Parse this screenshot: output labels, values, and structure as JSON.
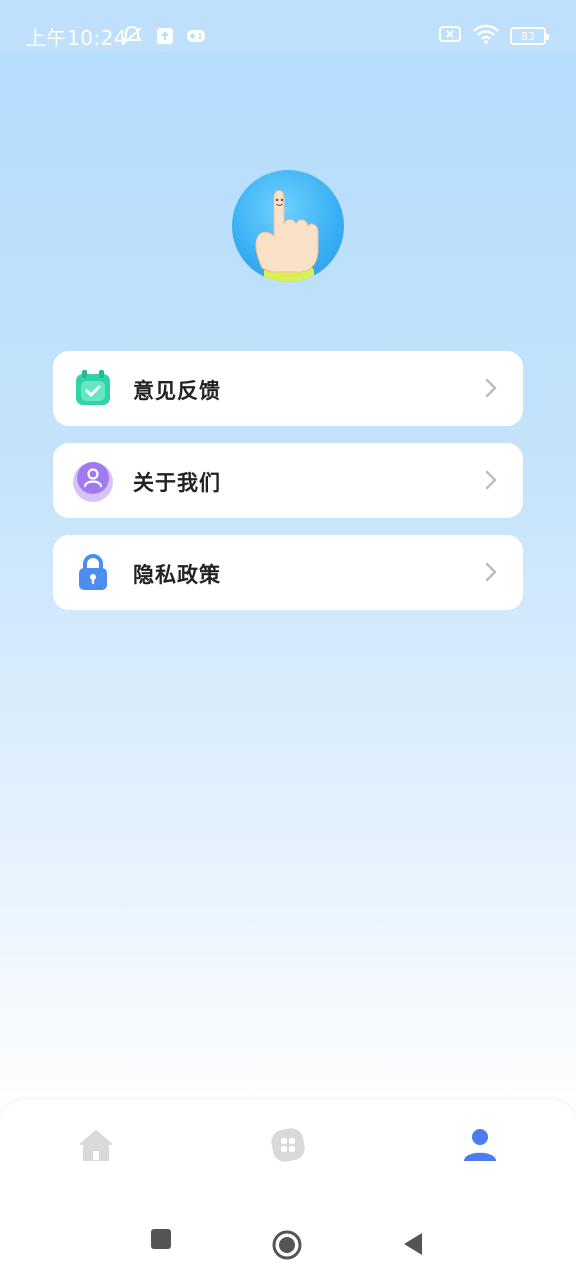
{
  "status_bar": {
    "time": "上午10:24",
    "battery_level": "83",
    "icons": [
      "alarm-off-icon",
      "upload-icon",
      "gamepad-icon",
      "sim-error-icon",
      "wifi-icon",
      "battery-icon"
    ]
  },
  "profile": {
    "avatar_icon": "pointing-hand-avatar"
  },
  "menu": {
    "items": [
      {
        "label": "意见反馈",
        "icon": "feedback-calendar-check-icon",
        "color": "#2fd5a8"
      },
      {
        "label": "关于我们",
        "icon": "about-us-person-icon",
        "color": "#a27af0"
      },
      {
        "label": "隐私政策",
        "icon": "privacy-lock-icon",
        "color": "#4b8ef0"
      }
    ]
  },
  "bottom_nav": {
    "tabs": [
      {
        "icon": "home-icon",
        "active": false
      },
      {
        "icon": "apps-grid-icon",
        "active": false
      },
      {
        "icon": "profile-person-icon",
        "active": true
      }
    ],
    "active_color": "#4d7cf0",
    "inactive_color": "#d9d9d9"
  },
  "system_nav": {
    "buttons": [
      "recent-apps-button",
      "home-button",
      "back-button"
    ]
  }
}
